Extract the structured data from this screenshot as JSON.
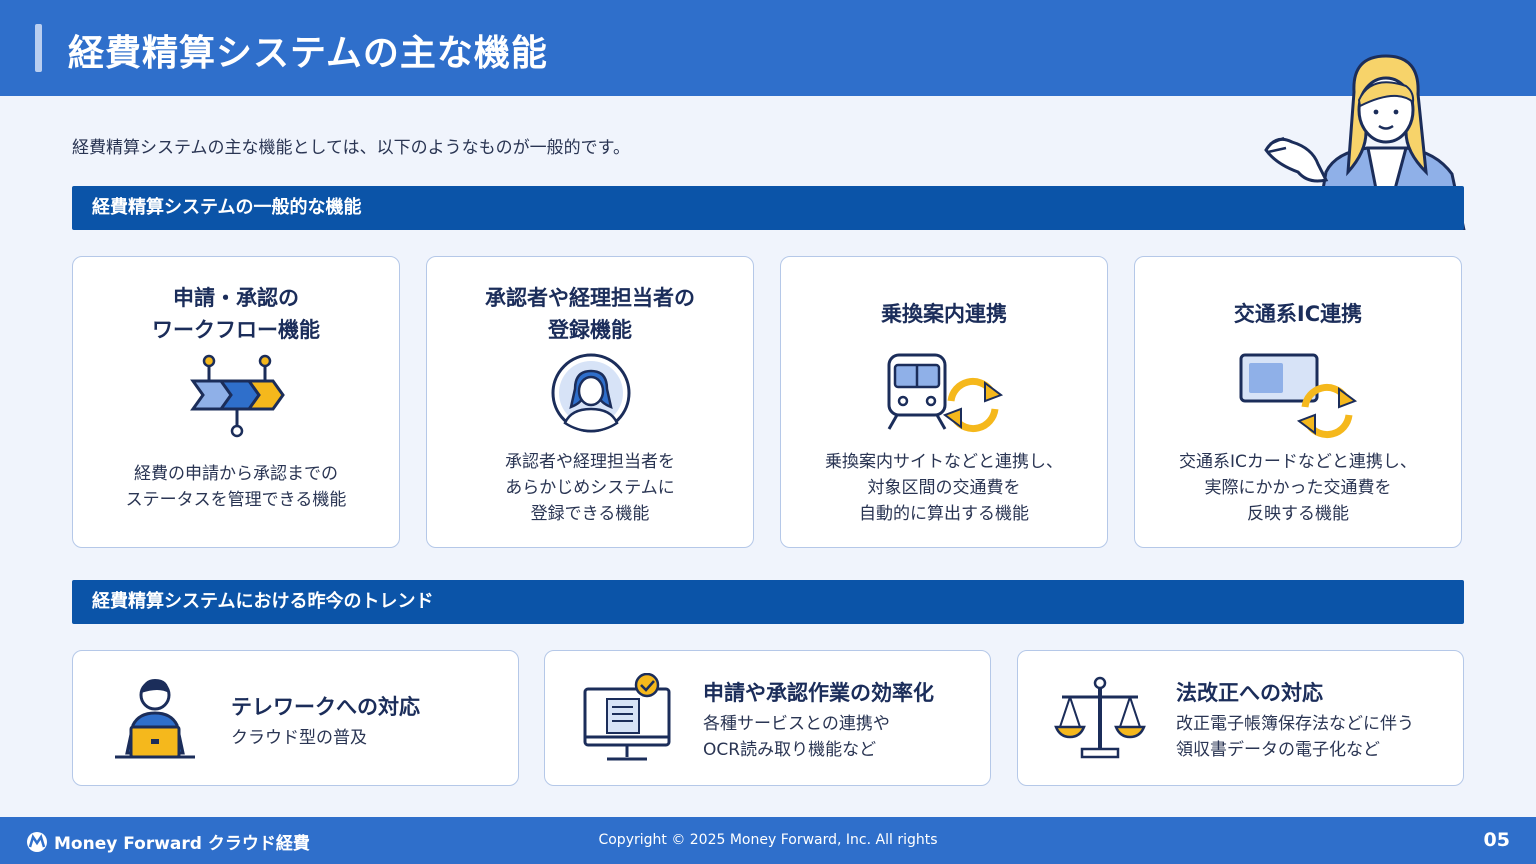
{
  "header": {
    "title": "経費精算システムの主な機能"
  },
  "intro": "経費精算システムの主な機能としては、以下のようなものが一般的です。",
  "sections": {
    "functions": "経費精算システムの一般的な機能",
    "trends": "経費精算システムにおける昨今のトレンド"
  },
  "cards": [
    {
      "title": "申請・承認の\nワークフロー機能",
      "icon": "workflow-icon",
      "desc": "経費の申請から承認までの\nステータスを管理できる機能"
    },
    {
      "title": "承認者や経理担当者の\n登録機能",
      "icon": "approver-avatar-icon",
      "desc": "承認者や経理担当者を\nあらかじめシステムに\n登録できる機能"
    },
    {
      "title": "乗換案内連携",
      "icon": "train-sync-icon",
      "desc": "乗換案内サイトなどと連携し、\n対象区間の交通費を\n自動的に算出する機能"
    },
    {
      "title": "交通系IC連携",
      "icon": "ic-card-sync-icon",
      "desc": "交通系ICカードなどと連携し、\n実際にかかった交通費を\n反映する機能"
    }
  ],
  "trends": [
    {
      "title": "テレワークへの対応",
      "icon": "telework-icon",
      "desc": "クラウド型の普及"
    },
    {
      "title": "申請や承認作業の効率化",
      "icon": "monitor-check-icon",
      "desc": "各種サービスとの連携や\nOCR読み取り機能など"
    },
    {
      "title": "法改正への対応",
      "icon": "scales-icon",
      "desc": "改正電子帳簿保存法などに伴う\n領収書データの電子化など"
    }
  ],
  "footer": {
    "brand": "Money Forward クラウド経費",
    "copyright": "Copyright © 2025 Money Forward, Inc. All rights",
    "page": "05"
  },
  "colors": {
    "primary": "#2f6fcb",
    "section": "#0b54a8",
    "accent": "#f5b81c",
    "light": "#b9cef0"
  }
}
